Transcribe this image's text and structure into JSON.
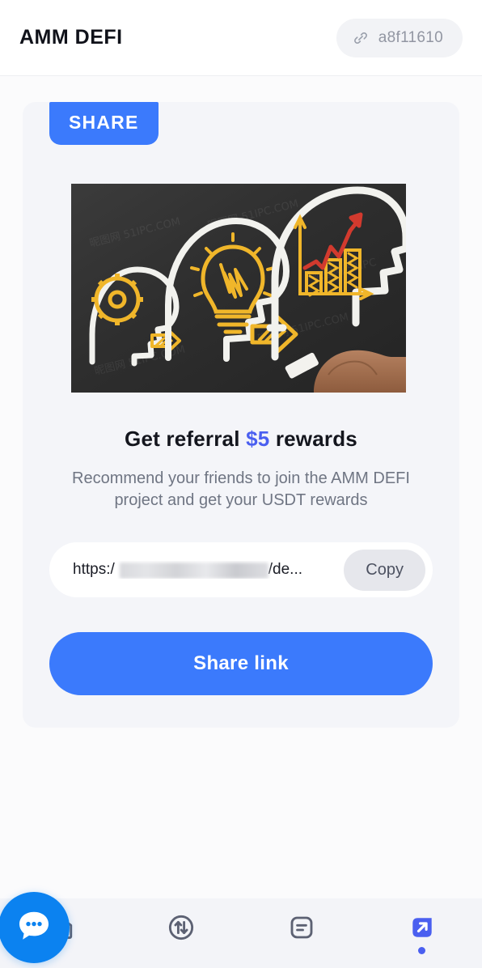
{
  "header": {
    "app_title": "AMM DEFI",
    "wallet_icon": "link-chain-icon",
    "wallet_address": "a8f11610"
  },
  "card": {
    "badge_label": "SHARE",
    "hero_image_alt": "chalkboard-illustration-heads-gear-lightbulb-growth-chart",
    "headline_prefix": "Get referral ",
    "headline_amount": "$5",
    "headline_suffix": " rewards",
    "description": "Recommend your friends to join the AMM DEFI project and get your USDT rewards",
    "referral_link_visible": "https:/",
    "referral_link_tail": "/de...",
    "referral_link_redacted": true,
    "copy_label": "Copy",
    "share_button_label": "Share link"
  },
  "tabbar": {
    "items": [
      {
        "name": "home",
        "icon": "home-icon",
        "active": false
      },
      {
        "name": "swap",
        "icon": "swap-circle-icon",
        "active": false
      },
      {
        "name": "orders",
        "icon": "document-lines-icon",
        "active": false
      },
      {
        "name": "share",
        "icon": "share-arrow-icon",
        "active": true
      }
    ],
    "chat_fab_icon": "chat-bubble-icon"
  },
  "colors": {
    "brand_blue": "#3b7afc",
    "accent_indigo": "#4a5ff0",
    "fab_blue": "#0b82f0",
    "page_bg": "#fbfbfc",
    "card_bg": "#f4f5f9",
    "tabbar_bg": "#f3f4f8",
    "muted_text": "#6f7583"
  }
}
